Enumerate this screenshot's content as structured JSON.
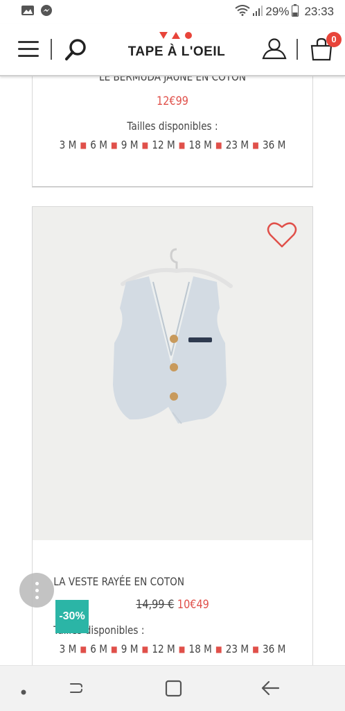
{
  "status": {
    "battery": "29%",
    "time": "23:33"
  },
  "header": {
    "brand": "TAPE À L'OEIL",
    "cart_count": "0"
  },
  "products": [
    {
      "name": "LE BERMUDA JAUNE EN COTON",
      "price": "12€99",
      "sizes_label": "Tailles disponibles :",
      "sizes": [
        "3 M",
        "6 M",
        "9 M",
        "12 M",
        "18 M",
        "23 M",
        "36 M"
      ]
    },
    {
      "name": "LA VESTE RAYÉE EN COTON",
      "old_price": "14,99 €",
      "price": "10€49",
      "discount": "-30%",
      "sizes_label": "Tailles disponibles :",
      "sizes": [
        "3 M",
        "6 M",
        "9 M",
        "12 M",
        "18 M",
        "23 M",
        "36 M"
      ]
    }
  ],
  "colors": {
    "accent_red": "#e0504a",
    "discount_teal": "#2bb5a6"
  },
  "icons": {
    "status_left": [
      "gallery-icon",
      "messenger-icon"
    ],
    "status_right": [
      "wifi-icon",
      "signal-icon",
      "battery-icon"
    ],
    "header": [
      "menu-icon",
      "search-icon",
      "user-icon",
      "shopping-bag-icon"
    ],
    "card": [
      "heart-icon",
      "more-options-icon"
    ],
    "nav": [
      "home-dot-icon",
      "recent-apps-icon",
      "home-square-icon",
      "back-icon"
    ]
  }
}
